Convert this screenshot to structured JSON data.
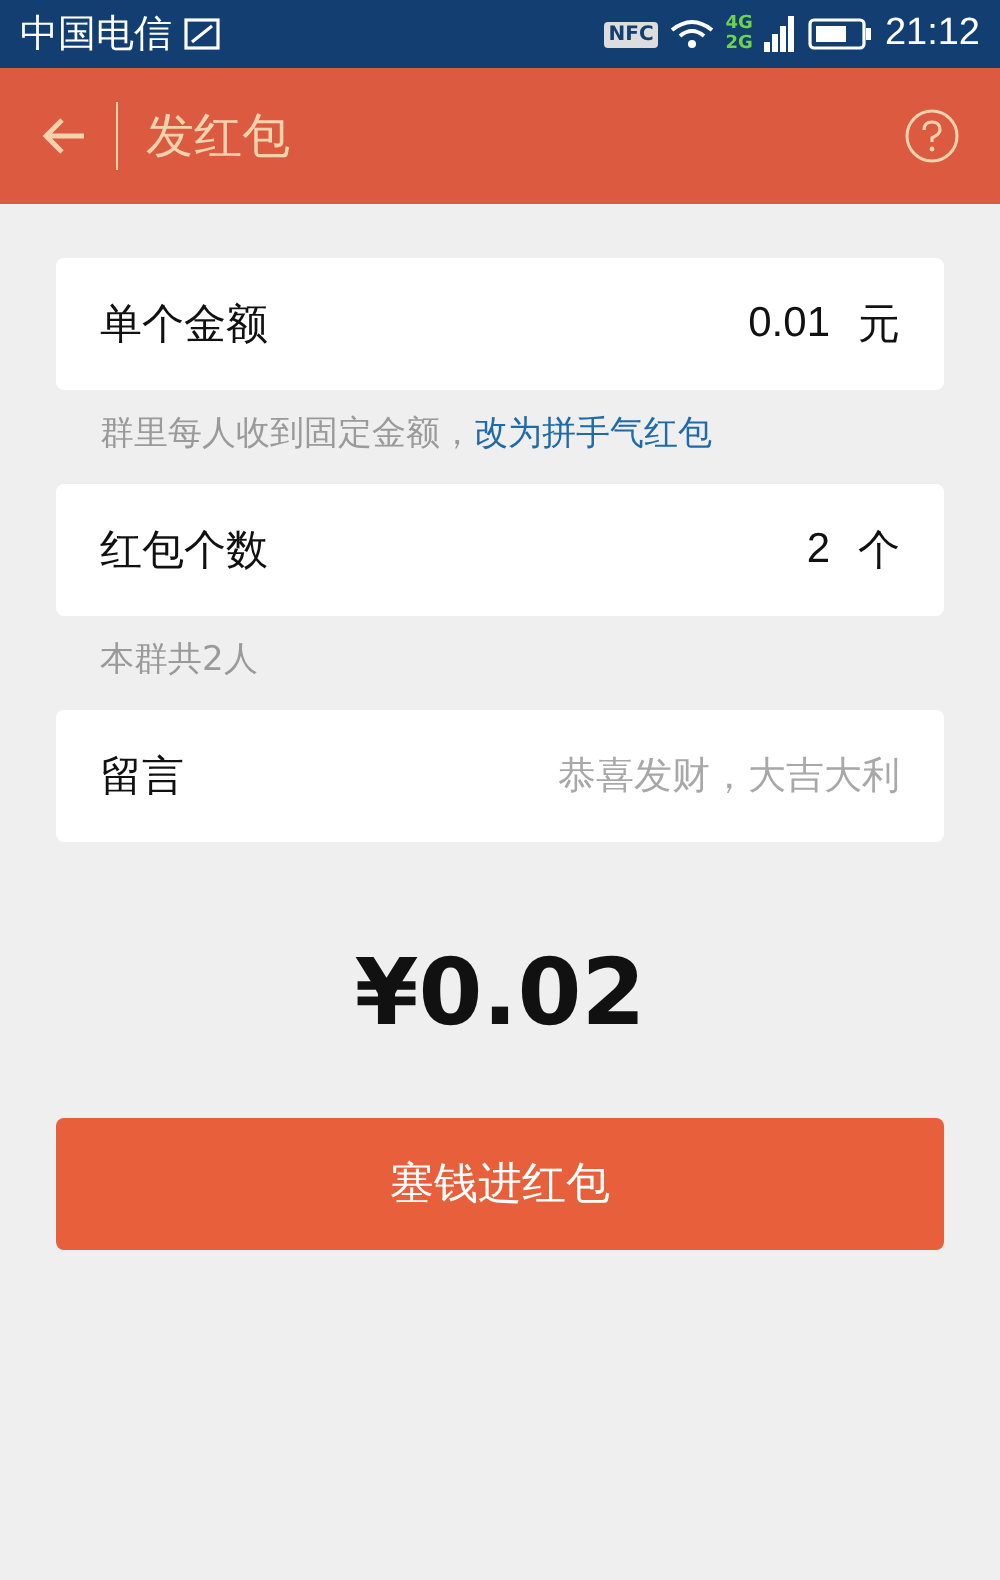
{
  "status_bar": {
    "carrier": "中国电信",
    "nfc": "NFC",
    "network_top": "4G",
    "network_bottom": "2G",
    "time": "21:12"
  },
  "header": {
    "title": "发红包"
  },
  "fields": [
    {
      "kind": "value",
      "label": "单个金额",
      "value": "0.01",
      "unit": "元",
      "hint": "群里每人收到固定金额，",
      "hint_link": "改为拼手气红包"
    },
    {
      "kind": "value",
      "label": "红包个数",
      "value": "2",
      "unit": "个",
      "hint": "本群共2人"
    },
    {
      "kind": "input",
      "label": "留言",
      "placeholder": "恭喜发财，大吉大利"
    }
  ],
  "total": "¥0.02",
  "submit_button": "塞钱进红包"
}
